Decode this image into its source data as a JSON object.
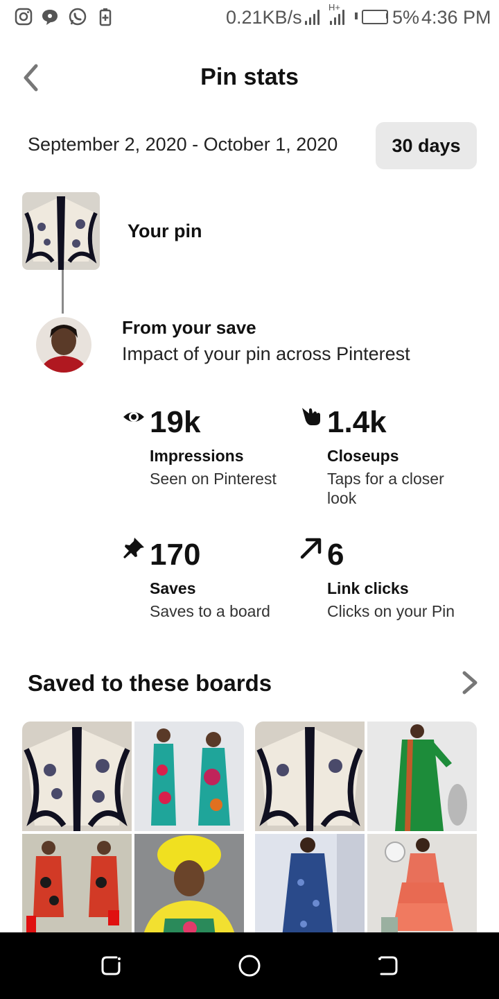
{
  "status_bar": {
    "speed": "0.21KB/s",
    "network_type": "H+",
    "battery_percent": "5%",
    "time": "4:36 PM",
    "icons": [
      "instagram-icon",
      "message-bubble-icon",
      "whatsapp-icon",
      "battery-saver-icon",
      "signal-icon",
      "battery-icon"
    ]
  },
  "header": {
    "title": "Pin stats",
    "back_icon": "chevron-left-icon"
  },
  "date_filter": {
    "range": "September 2, 2020 - October 1, 2020",
    "period_button": "30 days"
  },
  "pin": {
    "label": "Your pin"
  },
  "save": {
    "title": "From your save",
    "subtitle": "Impact of your pin across Pinterest"
  },
  "stats": [
    {
      "icon": "eye-icon",
      "value": "19k",
      "label": "Impressions",
      "description": "Seen on Pinterest"
    },
    {
      "icon": "tap-hand-icon",
      "value": "1.4k",
      "label": "Closeups",
      "description": "Taps for a closer look"
    },
    {
      "icon": "pin-icon",
      "value": "170",
      "label": "Saves",
      "description": "Saves to a board"
    },
    {
      "icon": "arrow-up-right-icon",
      "value": "6",
      "label": "Link clicks",
      "description": "Clicks on your Pin"
    }
  ],
  "boards": {
    "title": "Saved to these boards",
    "chevron_icon": "chevron-right-icon"
  },
  "nav_bar": {
    "icons": [
      "recents-icon",
      "home-icon",
      "back-nav-icon"
    ]
  },
  "colors": {
    "background": "#ffffff",
    "text": "#111111",
    "chip_bg": "#e9e9e9",
    "connector": "#8a8a8a",
    "nav_bar": "#000000"
  }
}
